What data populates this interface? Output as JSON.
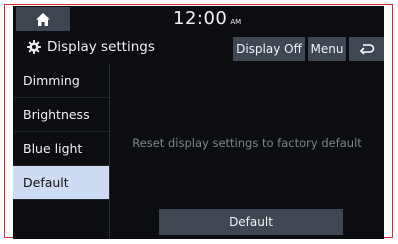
{
  "status": {
    "time": "12:00",
    "ampm": "AM"
  },
  "header": {
    "title": "Display settings",
    "display_off_label": "Display Off",
    "menu_label": "Menu"
  },
  "sidebar": {
    "items": [
      {
        "label": "Dimming"
      },
      {
        "label": "Brightness"
      },
      {
        "label": "Blue light"
      },
      {
        "label": "Default",
        "selected": true
      }
    ]
  },
  "main": {
    "message": "Reset display settings to factory default",
    "default_button_label": "Default"
  },
  "icons": {
    "home": "home-icon",
    "settings": "gear-icon",
    "back": "back-arrow-icon"
  },
  "colors": {
    "accent_selected": "#cddcf3",
    "button_bg": "#3f4752",
    "frame_border": "#e0262c"
  }
}
